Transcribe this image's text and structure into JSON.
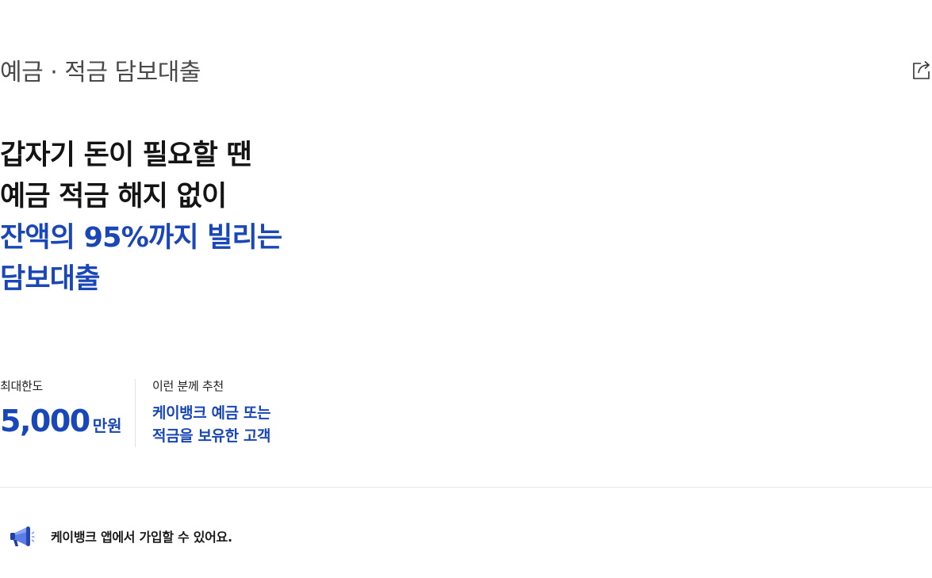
{
  "header": {
    "title": "예금 · 적금 담보대출",
    "share_icon": "share-icon"
  },
  "hero": {
    "lines_dark": [
      "갑자기 돈이 필요할 땐",
      "예금 적금 해지 없이"
    ],
    "lines_blue": [
      "잔액의 95%까지 빌리는",
      "담보대출"
    ]
  },
  "limit": {
    "label": "최대한도",
    "value": "5,000",
    "unit": "만원"
  },
  "recommend": {
    "label": "이런 분께 추천",
    "lines": [
      "케이뱅크 예금 또는",
      "적금을 보유한 고객"
    ]
  },
  "notice": {
    "icon": "megaphone-icon",
    "text": "케이뱅크 앱에서 가입할 수 있어요."
  },
  "colors": {
    "accent": "#1a47b8",
    "text": "#141414",
    "title_gray": "#4a4a4a",
    "divider": "#e8e8e8"
  }
}
